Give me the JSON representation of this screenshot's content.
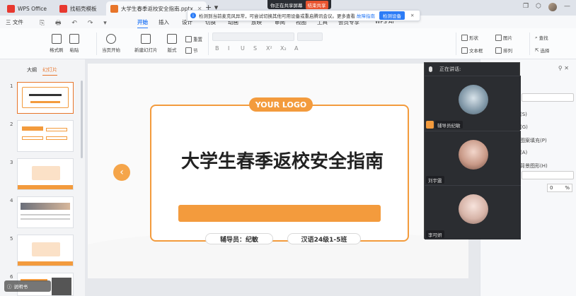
{
  "titlebar": {
    "tabs": [
      {
        "label": "WPS Office",
        "color": "#e8382f"
      },
      {
        "label": "找稻壳模板",
        "color": "#e8382f"
      },
      {
        "label": "大学生春季返校安全指南.pptx",
        "color": "#e8752a"
      }
    ],
    "share_status": "你正在共享屏幕",
    "share_end": "结束共享"
  },
  "notice": {
    "text": "检测到当前麦克风异常，可尝试切换其他可用设备或重启腾讯会议。更多查看",
    "link": "故障指南",
    "button": "检测设备"
  },
  "menubar": {
    "file": "三 文件",
    "items": [
      "开始",
      "插入",
      "设计",
      "切换",
      "动画",
      "放映",
      "审阅",
      "视图",
      "工具",
      "会员专享",
      "WPS AI"
    ]
  },
  "ribbon": {
    "format_painter": "格式刷",
    "paste": "粘贴",
    "play": "当页开始",
    "new_slide": "新建幻灯片",
    "layout": "版式",
    "section": "节",
    "reset": "重置",
    "shape": "形状",
    "image": "图片",
    "textbox": "文本框",
    "arrange": "排列",
    "find": "查找",
    "select": "选择",
    "font_buttons": [
      "B",
      "I",
      "U",
      "S",
      "X²",
      "X₂",
      "A"
    ]
  },
  "left_panel": {
    "tabs": [
      "大纲",
      "幻灯片"
    ],
    "slide_numbers": [
      "1",
      "2",
      "3",
      "4",
      "5",
      "6"
    ],
    "bottom_label": "说明书"
  },
  "slide": {
    "logo": "YOUR LOGO",
    "title": "大学生春季返校安全指南",
    "counselor": "辅导员：纪敏",
    "class": "汉语24级1-5班"
  },
  "right_panel": {
    "options": [
      "(S)",
      "(G)",
      "图案填充(P)",
      "(A)",
      "背景图形(H)"
    ],
    "percent": "0",
    "percent_unit": "%"
  },
  "meeting": {
    "speaking": "正在讲话:",
    "participants": [
      {
        "name": "辅导员纪敏",
        "host": true
      },
      {
        "name": "刘宇震",
        "host": false
      },
      {
        "name": "李可妍",
        "host": false
      }
    ]
  },
  "colors": {
    "accent": "#f39b3d",
    "wps_blue": "#2c7cf6"
  }
}
